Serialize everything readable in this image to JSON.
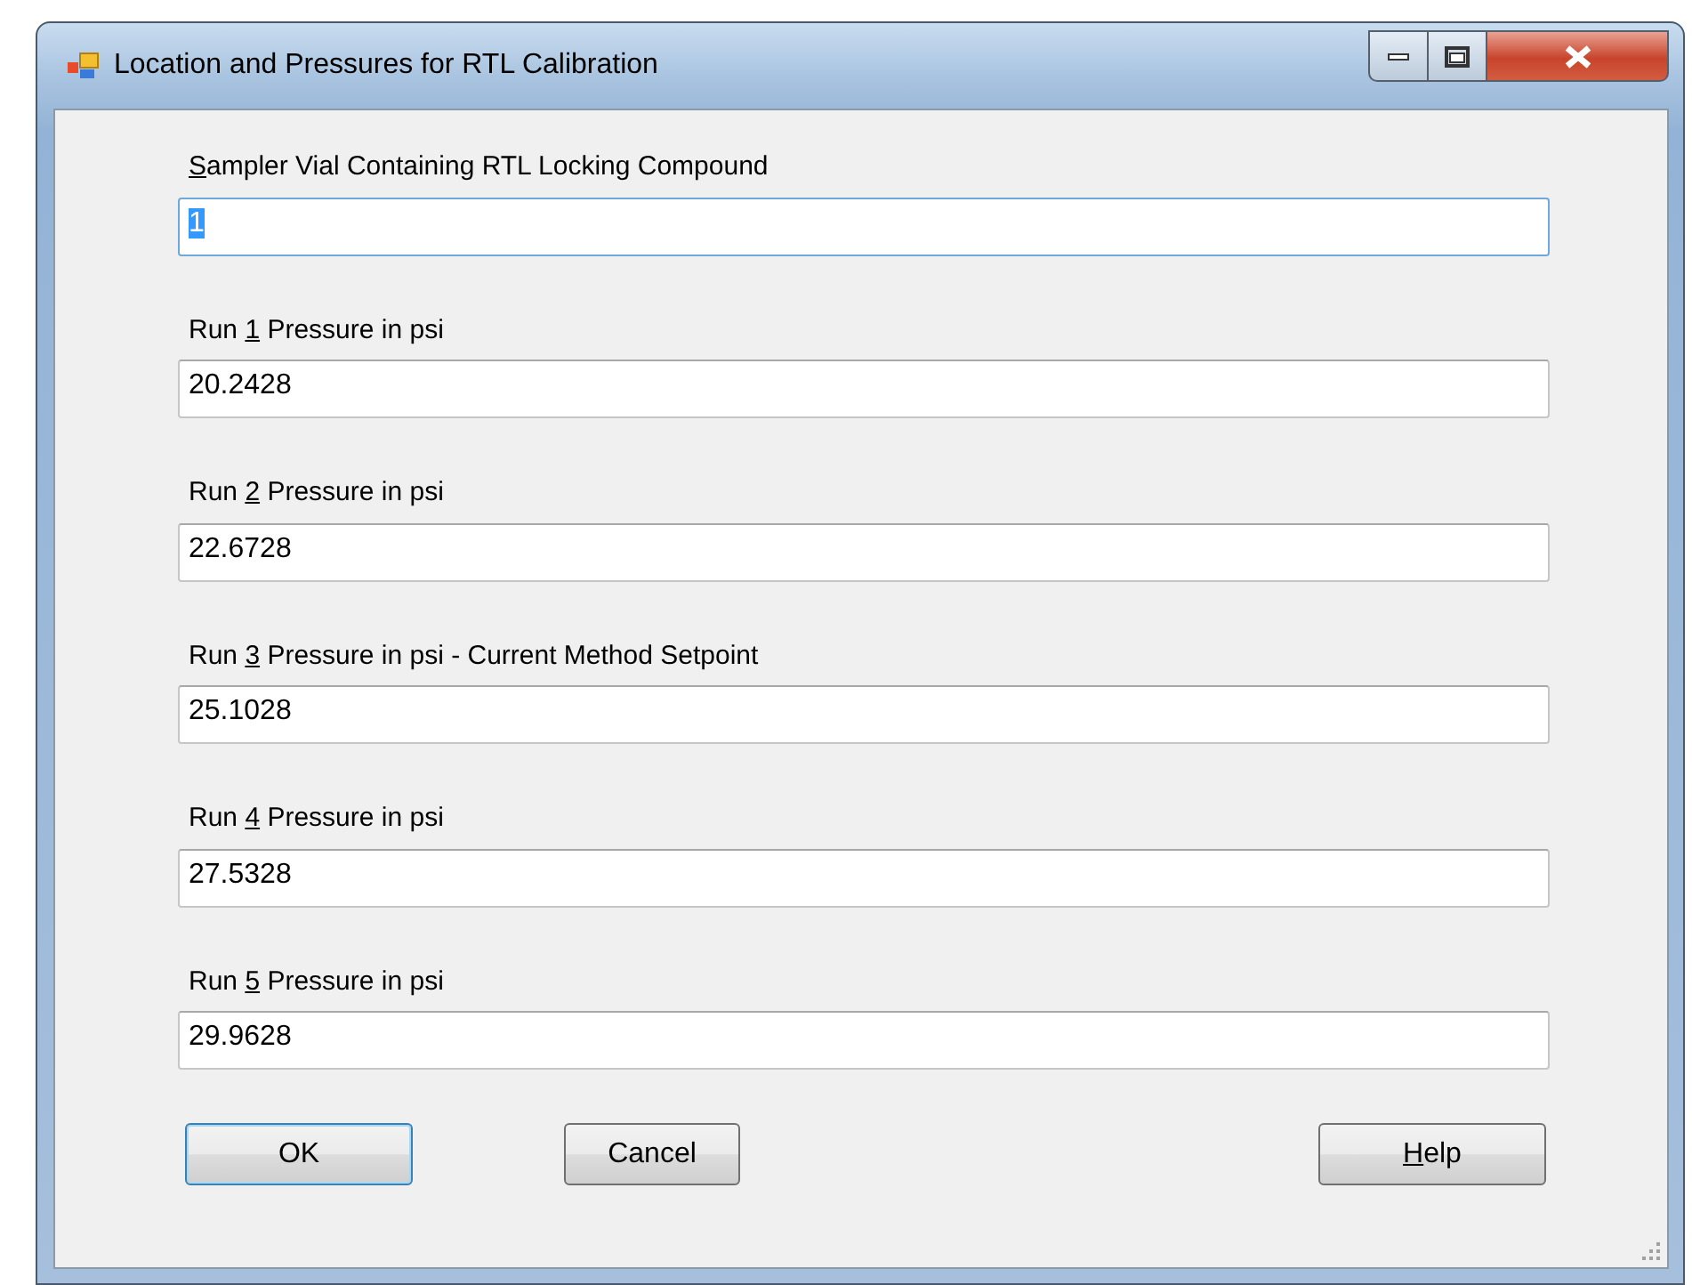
{
  "window": {
    "title": "Location and Pressures for RTL Calibration",
    "controls": [
      {
        "kind": "minimize"
      },
      {
        "kind": "maximize"
      },
      {
        "kind": "close"
      }
    ]
  },
  "fields": [
    {
      "label": {
        "access_key": "S",
        "after": "ampler Vial Containing RTL Locking Compound"
      },
      "value": "1",
      "focused": true
    },
    {
      "label": {
        "before": "Run ",
        "access_key": "1",
        "after": " Pressure in psi"
      },
      "value": "20.2428",
      "focused": false
    },
    {
      "label": {
        "before": "Run ",
        "access_key": "2",
        "after": " Pressure in psi"
      },
      "value": "22.6728",
      "focused": false
    },
    {
      "label": {
        "before": "Run ",
        "access_key": "3",
        "after": " Pressure in psi - Current Method Setpoint"
      },
      "value": "25.1028",
      "focused": false
    },
    {
      "label": {
        "before": "Run ",
        "access_key": "4",
        "after": " Pressure in psi"
      },
      "value": "27.5328",
      "focused": false
    },
    {
      "label": {
        "before": "Run ",
        "access_key": "5",
        "after": " Pressure in psi"
      },
      "value": "29.9628",
      "focused": false
    }
  ],
  "buttons": [
    {
      "label": {
        "before": "OK"
      },
      "default": true
    },
    {
      "label": {
        "before": "Cancel"
      },
      "default": false
    },
    {
      "label": {
        "access_key": "H",
        "after": "elp"
      },
      "default": false
    }
  ]
}
